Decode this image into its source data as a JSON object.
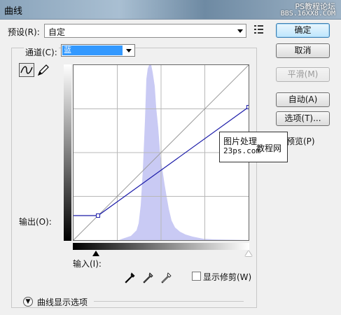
{
  "window": {
    "title": "曲线",
    "watermark_line1": "PS教程论坛",
    "watermark_line2": "BBS.16XX8.COM"
  },
  "preset": {
    "label": "预设(R):",
    "value": "自定"
  },
  "buttons": {
    "ok": "确定",
    "cancel": "取消",
    "smooth": "平滑(M)",
    "auto": "自动(A)",
    "options": "选项(T)..."
  },
  "preview": {
    "label": "预览(P)",
    "checked": true
  },
  "channel": {
    "label": "通道(C):",
    "value": "蓝"
  },
  "graph": {
    "output_label": "输出(O):",
    "input_label": "输入(I):",
    "curve_points": [
      [
        0,
        0.14
      ],
      [
        0.14,
        0.14
      ],
      [
        1,
        0.76
      ]
    ],
    "curve_color": "#1a1aa8",
    "histogram_color": "#c9caf4"
  },
  "clipping": {
    "label": "显示修剪(W)",
    "checked": false
  },
  "curve_display_options": {
    "label": "曲线显示选项"
  },
  "watermark_box": {
    "line1": "图片处理",
    "line2": "23ps.com",
    "line3": "教程网"
  }
}
